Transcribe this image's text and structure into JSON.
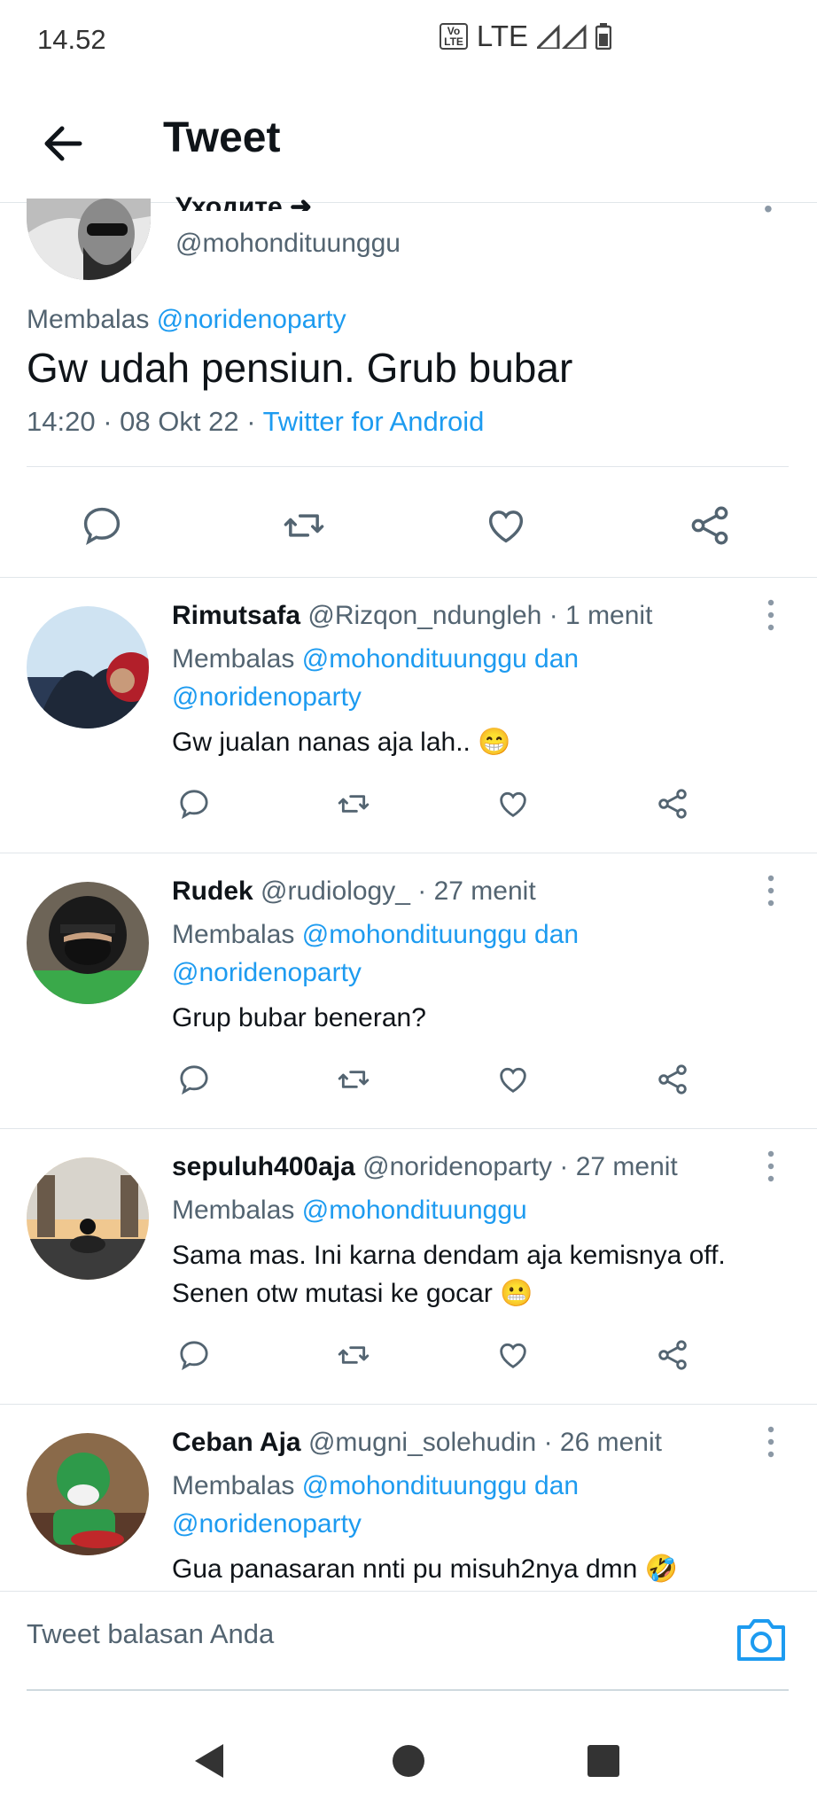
{
  "status_bar": {
    "time": "14.52",
    "volte": "Vo\nLTE",
    "network": "LTE"
  },
  "header": {
    "title": "Tweet"
  },
  "main_tweet": {
    "name_partial": "Уходите ➜",
    "handle": "@mohondituunggu",
    "reply_prefix": "Membalas",
    "reply_to": "@noridenoparty",
    "text": "Gw udah pensiun. Grub bubar",
    "time": "14:20",
    "date": "08 Okt 22",
    "source": "Twitter for Android"
  },
  "replies": [
    {
      "name": "Rimutsafa",
      "handle": "@Rizqon_ndungleh",
      "time": "· 1 menit",
      "reply_prefix": "Membalas",
      "reply_to_1": "@mohondituunggu dan",
      "reply_to_2": "@noridenoparty",
      "text": "Gw jualan nanas aja lah.. 😁"
    },
    {
      "name": "Rudek",
      "handle": "@rudiology_",
      "time": "· 27 menit",
      "reply_prefix": "Membalas",
      "reply_to_1": "@mohondituunggu dan",
      "reply_to_2": "@noridenoparty",
      "text": "Grup bubar beneran?"
    },
    {
      "name": "sepuluh400aja",
      "handle": "@noridenoparty",
      "time": "· 27 menit",
      "reply_prefix": "Membalas",
      "reply_to_1": "@mohondituunggu",
      "reply_to_2": "",
      "text": "Sama mas. Ini karna dendam aja kemisnya off. Senen otw mutasi ke gocar 😬"
    },
    {
      "name": "Ceban Aja",
      "handle": "@mugni_solehudin",
      "time": "· 26 menit",
      "reply_prefix": "Membalas",
      "reply_to_1": "@mohondituunggu dan",
      "reply_to_2": "@noridenoparty",
      "text": "Gua panasaran nnti pu misuh2nya dmn 🤣"
    }
  ],
  "composer": {
    "placeholder": "Tweet balasan Anda"
  },
  "colors": {
    "accent": "#1d9bf0",
    "secondary_text": "#536471",
    "divider": "#e1e6ea"
  }
}
